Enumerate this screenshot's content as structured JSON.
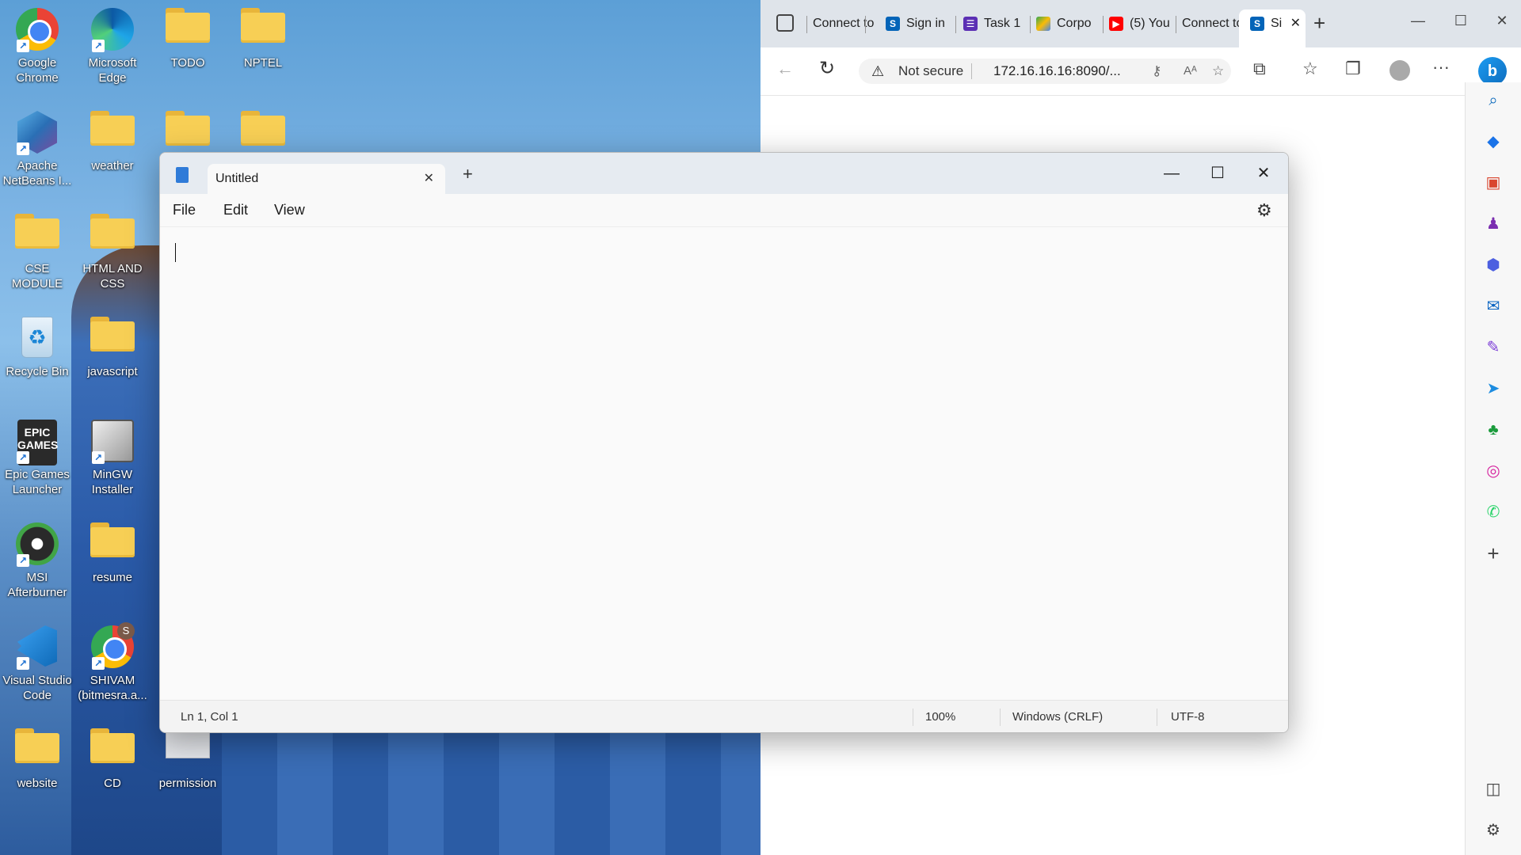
{
  "desktop": {
    "icons": [
      {
        "label": "Google Chrome",
        "kind": "chrome"
      },
      {
        "label": "Microsoft Edge",
        "kind": "edge"
      },
      {
        "label": "TODO",
        "kind": "folder"
      },
      {
        "label": "NPTEL",
        "kind": "folder"
      },
      {
        "label": "Apache NetBeans I...",
        "kind": "netbeans"
      },
      {
        "label": "weather",
        "kind": "folder"
      },
      {
        "label": "CSE MODULE",
        "kind": "folder"
      },
      {
        "label": "HTML AND CSS",
        "kind": "folder"
      },
      {
        "label": "Recycle Bin",
        "kind": "recycle"
      },
      {
        "label": "javascript",
        "kind": "folder"
      },
      {
        "label": "Epic Games Launcher",
        "kind": "epic"
      },
      {
        "label": "MinGW Installer",
        "kind": "mingw"
      },
      {
        "label": "MSI Afterburner",
        "kind": "msi"
      },
      {
        "label": "resume",
        "kind": "folder"
      },
      {
        "label": "Visual Studio Code",
        "kind": "vscode"
      },
      {
        "label": "SHIVAM (bitmesra.a...",
        "kind": "chrome-profile"
      },
      {
        "label": "website",
        "kind": "folder"
      },
      {
        "label": "CD",
        "kind": "folder"
      },
      {
        "label": "permission",
        "kind": "file"
      }
    ],
    "epic_logo_text": "EPIC GAMES",
    "profile_badge": "S"
  },
  "browser": {
    "tabs": [
      {
        "label": "Connect to",
        "favicon": "page-icon"
      },
      {
        "label": "Sign in",
        "favicon": "s-icon"
      },
      {
        "label": "Task 1",
        "favicon": "list-icon"
      },
      {
        "label": "Corpo",
        "favicon": "drive-icon"
      },
      {
        "label": "(5) You",
        "favicon": "youtube-icon"
      },
      {
        "label": "Connect to",
        "favicon": "page-icon"
      },
      {
        "label": "Si",
        "favicon": "s-icon"
      }
    ],
    "address": {
      "security": "Not secure",
      "url": "172.16.16.16:8090/..."
    },
    "colors": {
      "sharepoint": "#0364b8",
      "youtube": "#ff0000",
      "tasks": "#5b2fb4",
      "edge_accent": "#0f6cbd"
    },
    "sidebar_icons": [
      "search-icon",
      "tag-icon",
      "toolbox-icon",
      "games-icon",
      "microsoft365-icon",
      "outlook-icon",
      "designer-icon",
      "send-icon",
      "tree-icon",
      "instagram-icon",
      "whatsapp-icon",
      "add-icon",
      "sidebar-toggle-icon",
      "settings-icon"
    ]
  },
  "notepad": {
    "tab_title": "Untitled",
    "menu": [
      "File",
      "Edit",
      "View"
    ],
    "status": {
      "position": "Ln 1, Col 1",
      "zoom": "100%",
      "line_endings": "Windows (CRLF)",
      "encoding": "UTF-8"
    }
  }
}
